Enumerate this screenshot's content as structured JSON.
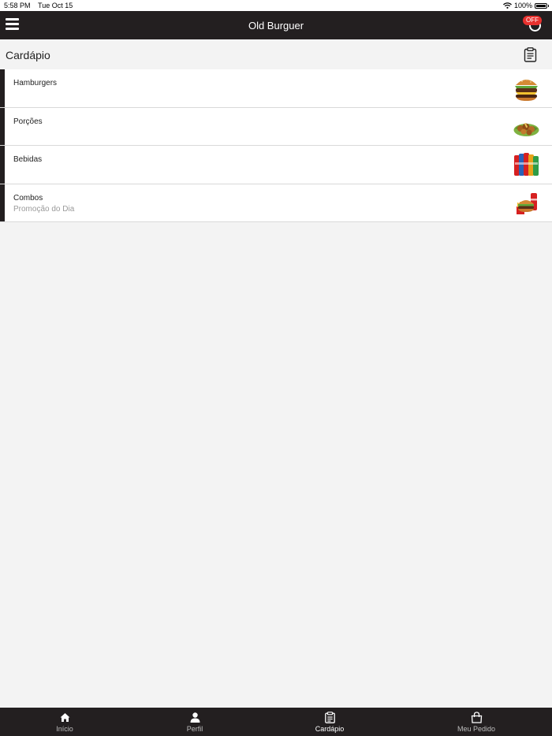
{
  "status_bar": {
    "time": "5:58 PM",
    "date": "Tue Oct 15",
    "battery": "100%"
  },
  "navbar": {
    "title": "Old Burguer",
    "off_badge": "OFF"
  },
  "page": {
    "title": "Cardápio"
  },
  "categories": [
    {
      "name": "Hamburgers",
      "subtitle": "",
      "image": "hamburger-image"
    },
    {
      "name": "Porções",
      "subtitle": "",
      "image": "portions-image"
    },
    {
      "name": "Bebidas",
      "subtitle": "",
      "image": "drinks-image"
    },
    {
      "name": "Combos",
      "subtitle": "Promoção do Dia",
      "image": "combo-image"
    }
  ],
  "tabbar": {
    "tabs": [
      {
        "label": "Início",
        "icon": "home-icon",
        "active": false
      },
      {
        "label": "Perfil",
        "icon": "person-icon",
        "active": false
      },
      {
        "label": "Cardápio",
        "icon": "clipboard-icon",
        "active": true
      },
      {
        "label": "Meu Pedido",
        "icon": "shopping-bag-icon",
        "active": false
      }
    ]
  },
  "colors": {
    "dark": "#231f20",
    "accent_red": "#e8312e",
    "background": "#f3f3f3"
  }
}
